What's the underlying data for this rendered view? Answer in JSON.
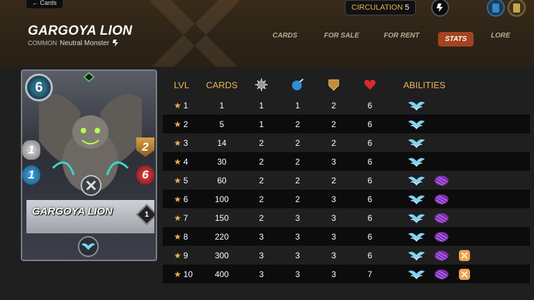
{
  "header": {
    "back_label": "← Cards",
    "card_name": "GARGOYA LION",
    "rarity": "COMMON",
    "type": "Neutral Monster",
    "circulation_label": "CIRCULATION",
    "circulation_value": "5"
  },
  "nav": {
    "tabs": [
      {
        "label": "CARDS",
        "active": false
      },
      {
        "label": "FOR SALE",
        "active": false
      },
      {
        "label": "FOR RENT",
        "active": false
      },
      {
        "label": "STATS",
        "active": true
      },
      {
        "label": "LORE",
        "active": false
      }
    ]
  },
  "card": {
    "name": "GARGOYA LION",
    "mana": "6",
    "attack": "1",
    "speed": "1",
    "armor": "2",
    "health": "6",
    "level": "1"
  },
  "stats_table": {
    "headers": {
      "level": "LVL",
      "cards": "CARDS",
      "attack_icon": "melee-attack-icon",
      "speed_icon": "speed-icon",
      "armor_icon": "armor-icon",
      "health_icon": "health-icon",
      "abilities": "ABILITIES"
    },
    "rows": [
      {
        "lvl": "1",
        "cards": "1",
        "attack": "1",
        "speed": "1",
        "armor": "2",
        "health": "6",
        "abilities": [
          "flying"
        ]
      },
      {
        "lvl": "2",
        "cards": "5",
        "attack": "1",
        "speed": "2",
        "armor": "2",
        "health": "6",
        "abilities": [
          "flying"
        ]
      },
      {
        "lvl": "3",
        "cards": "14",
        "attack": "2",
        "speed": "2",
        "armor": "2",
        "health": "6",
        "abilities": [
          "flying"
        ]
      },
      {
        "lvl": "4",
        "cards": "30",
        "attack": "2",
        "speed": "2",
        "armor": "3",
        "health": "6",
        "abilities": [
          "flying"
        ]
      },
      {
        "lvl": "5",
        "cards": "60",
        "attack": "2",
        "speed": "2",
        "armor": "2",
        "health": "6",
        "abilities": [
          "flying",
          "void"
        ]
      },
      {
        "lvl": "6",
        "cards": "100",
        "attack": "2",
        "speed": "2",
        "armor": "3",
        "health": "6",
        "abilities": [
          "flying",
          "void"
        ]
      },
      {
        "lvl": "7",
        "cards": "150",
        "attack": "2",
        "speed": "3",
        "armor": "3",
        "health": "6",
        "abilities": [
          "flying",
          "void"
        ]
      },
      {
        "lvl": "8",
        "cards": "220",
        "attack": "3",
        "speed": "3",
        "armor": "3",
        "health": "6",
        "abilities": [
          "flying",
          "void"
        ]
      },
      {
        "lvl": "9",
        "cards": "300",
        "attack": "3",
        "speed": "3",
        "armor": "3",
        "health": "6",
        "abilities": [
          "flying",
          "void",
          "shatter"
        ]
      },
      {
        "lvl": "10",
        "cards": "400",
        "attack": "3",
        "speed": "3",
        "armor": "3",
        "health": "7",
        "abilities": [
          "flying",
          "void",
          "shatter"
        ]
      }
    ]
  },
  "colors": {
    "accent": "#e9b453",
    "active_tab": "#a4431f",
    "row_dark": "#0c0c0c",
    "background": "#1f1f1f"
  }
}
